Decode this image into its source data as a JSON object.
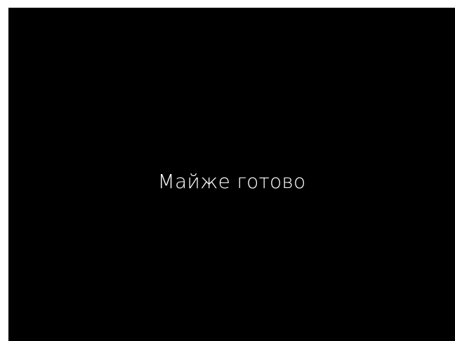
{
  "screen": {
    "status_message": "Майже готово",
    "background_color": "#000000",
    "text_color": "#ffffff"
  }
}
